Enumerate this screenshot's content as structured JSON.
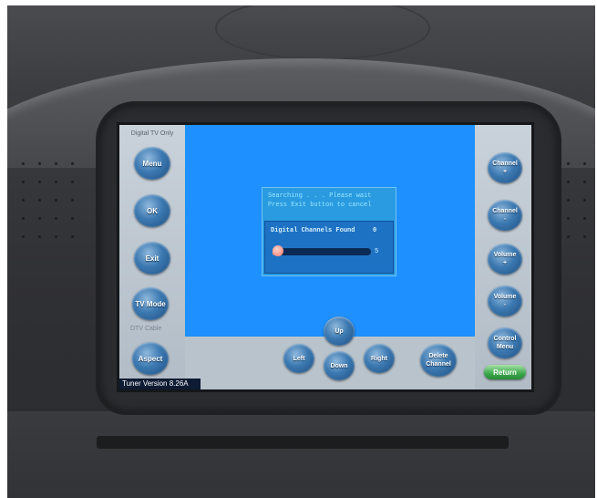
{
  "left_panel": {
    "header": "Digital TV Only",
    "buttons": [
      "Menu",
      "OK",
      "Exit",
      "TV Mode",
      "Aspect"
    ],
    "mode_label": "DTV Cable"
  },
  "right_panel": {
    "buttons": [
      "Channel\n+",
      "Channel\n-",
      "Volume\n+",
      "Volume\n-",
      "Control\nMenu"
    ],
    "return_label": "Return"
  },
  "bottom_controls": {
    "buttons": [
      "Up",
      "Left",
      "Down",
      "Right",
      "Delete\nChannel"
    ]
  },
  "dialog": {
    "line1": "Searching . . . Please wait",
    "line2": "Press Exit button to cancel",
    "found_label": "Digital Channels Found",
    "found_value": "0",
    "progress_label": "5",
    "progress_fraction": 0.05
  },
  "status": {
    "version": "Tuner Version 8.26A"
  },
  "colors": {
    "screen_blue": "#1e90ff",
    "button_blue": "#3c79b1",
    "return_green": "#3aa84a",
    "progress": "#ff8f8f"
  }
}
